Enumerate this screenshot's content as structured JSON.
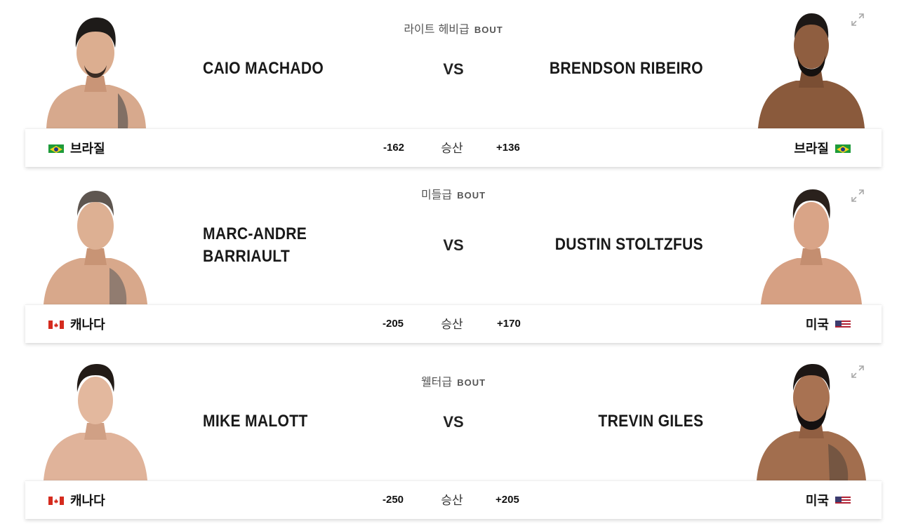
{
  "bouts": [
    {
      "weight_class": "라이트 헤비급",
      "bout_label": "BOUT",
      "vs_label": "VS",
      "red": {
        "name_line1": "CAIO MACHADO",
        "name_line2": "",
        "country": "브라질",
        "flag": "brazil-flag",
        "odds": "-162"
      },
      "blue": {
        "name_line1": "BRENDSON RIBEIRO",
        "name_line2": "",
        "country": "브라질",
        "flag": "brazil-flag",
        "odds": "+136"
      },
      "result_label": "승산"
    },
    {
      "weight_class": "미들급",
      "bout_label": "BOUT",
      "vs_label": "VS",
      "red": {
        "name_line1": "MARC-ANDRE",
        "name_line2": "BARRIAULT",
        "country": "캐나다",
        "flag": "canada-flag",
        "odds": "-205"
      },
      "blue": {
        "name_line1": "DUSTIN STOLTZFUS",
        "name_line2": "",
        "country": "미국",
        "flag": "usa-flag",
        "odds": "+170"
      },
      "result_label": "승산"
    },
    {
      "weight_class": "웰터급",
      "bout_label": "BOUT",
      "vs_label": "VS",
      "red": {
        "name_line1": "MIKE MALOTT",
        "name_line2": "",
        "country": "캐나다",
        "flag": "canada-flag",
        "odds": "-250"
      },
      "blue": {
        "name_line1": "TREVIN GILES",
        "name_line2": "",
        "country": "미국",
        "flag": "usa-flag",
        "odds": "+205"
      },
      "result_label": "승산"
    }
  ],
  "colors": {
    "skin": "#d9a98a",
    "skin_dark": "#8a5a3c",
    "hair": "#1c1a18",
    "shadow": "#b8b8b8",
    "text": "#191919"
  },
  "icons": {
    "expand": "expand-icon"
  }
}
